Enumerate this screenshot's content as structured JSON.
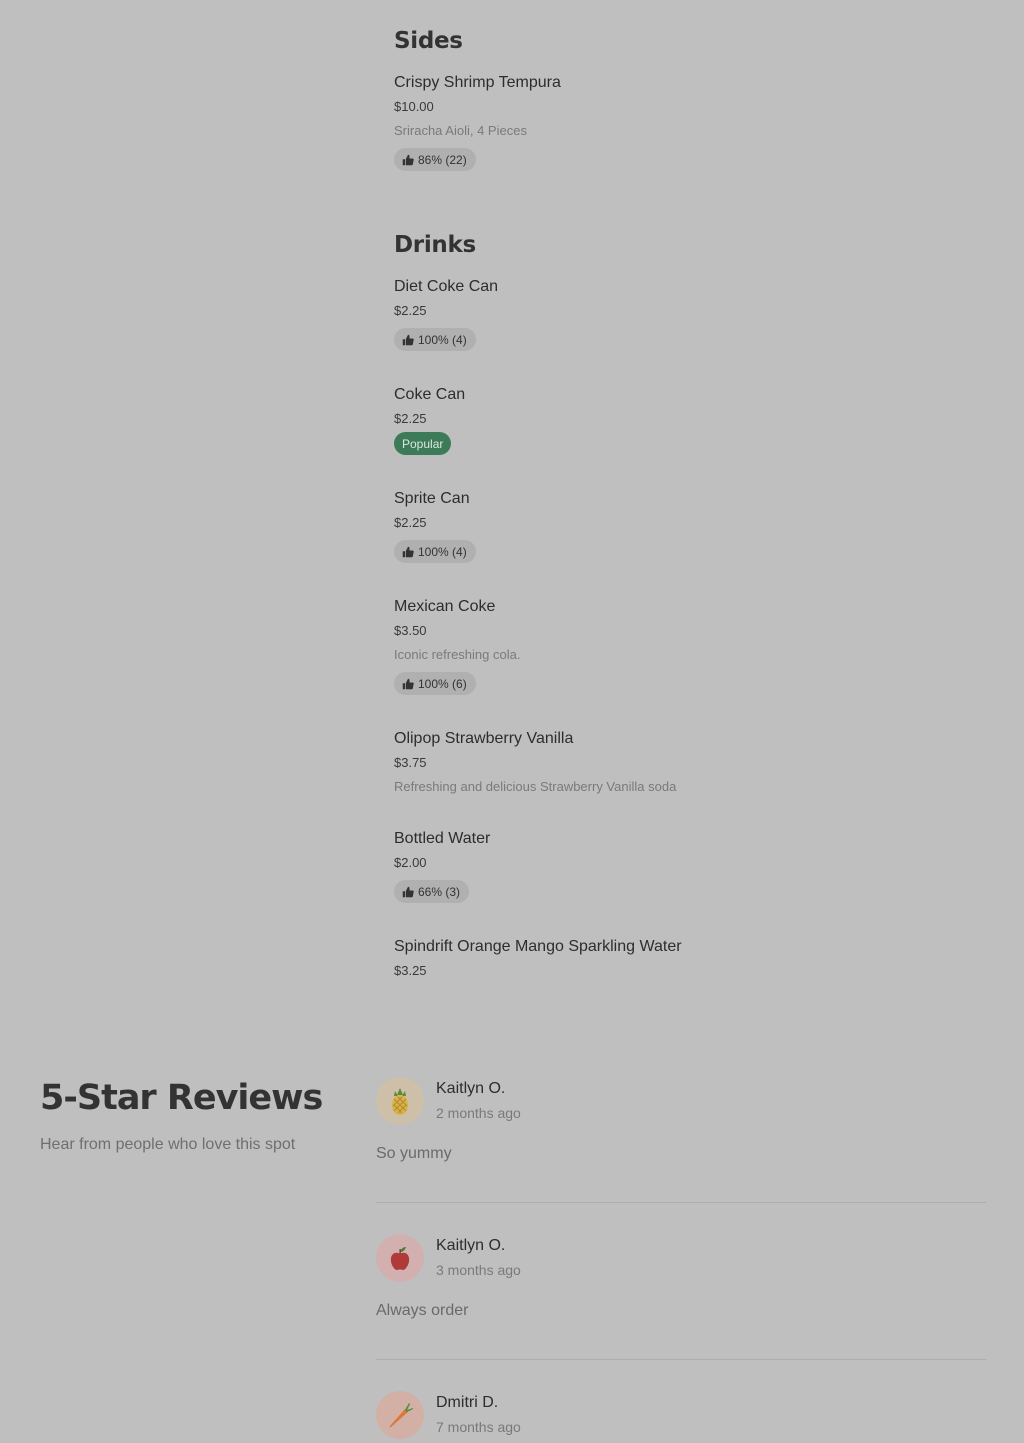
{
  "sections": {
    "sides": {
      "title": "Sides",
      "items": [
        {
          "name": "Crispy Shrimp Tempura",
          "price": "$10.00",
          "description": "Sriracha Aioli, 4 Pieces",
          "rating": "86% (22)"
        }
      ]
    },
    "drinks": {
      "title": "Drinks",
      "items": [
        {
          "name": "Diet Coke Can",
          "price": "$2.25",
          "rating": "100% (4)"
        },
        {
          "name": "Coke Can",
          "price": "$2.25",
          "badge": "Popular"
        },
        {
          "name": "Sprite Can",
          "price": "$2.25",
          "rating": "100% (4)"
        },
        {
          "name": "Mexican Coke",
          "price": "$3.50",
          "description": "Iconic refreshing cola.",
          "rating": "100% (6)"
        },
        {
          "name": "Olipop Strawberry Vanilla",
          "price": "$3.75",
          "description": "Refreshing and delicious Strawberry Vanilla soda"
        },
        {
          "name": "Bottled Water",
          "price": "$2.00",
          "rating": "66% (3)"
        },
        {
          "name": "Spindrift Orange Mango Sparkling Water",
          "price": "$3.25"
        }
      ]
    }
  },
  "reviews": {
    "heading": "5-Star Reviews",
    "subheading": "Hear from people who love this spot",
    "items": [
      {
        "name": "Kaitlyn O.",
        "time": "2 months ago",
        "text": "So yummy",
        "avatar_icon": "pineapple-icon",
        "avatar_color": "#cdbfa8"
      },
      {
        "name": "Kaitlyn O.",
        "time": "3 months ago",
        "text": "Always order",
        "avatar_icon": "apple-icon",
        "avatar_color": "#d2b0b0"
      },
      {
        "name": "Dmitri D.",
        "time": "7 months ago",
        "text": "",
        "avatar_icon": "carrot-icon",
        "avatar_color": "#d2b0a6"
      }
    ]
  },
  "icons": {
    "rating": "thumbs-up-icon"
  },
  "colors": {
    "background": "#bfbfbf",
    "popular_badge": "#3c7a58",
    "rating_pill": "#b0b0b0"
  }
}
